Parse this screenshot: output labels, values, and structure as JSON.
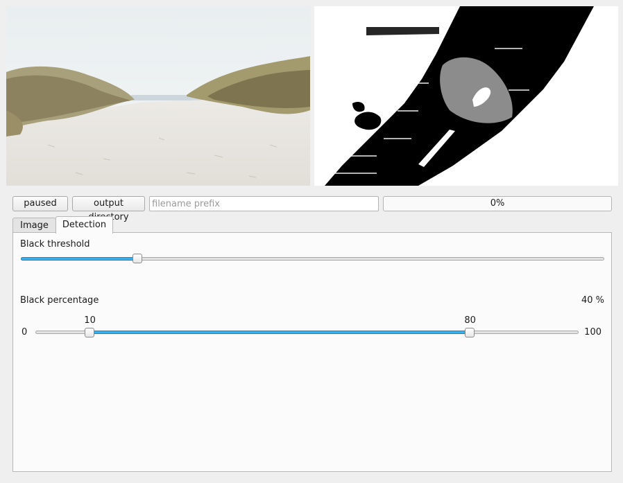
{
  "toolbar": {
    "paused_label": "paused",
    "output_directory_label": "output directory",
    "filename_prefix_placeholder": "filename prefix",
    "filename_prefix_value": "",
    "progress_text": "0%",
    "progress_value": 0
  },
  "tabs": [
    {
      "label": "Image",
      "active": false
    },
    {
      "label": "Detection",
      "active": true
    }
  ],
  "detection": {
    "black_threshold": {
      "label": "Black threshold",
      "value_fraction": 0.2
    },
    "black_percentage": {
      "label": "Black percentage",
      "current_text": "40 %",
      "range_min_text": "0",
      "range_max_text": "100",
      "lower_text": "10",
      "upper_text": "80",
      "min": 0,
      "max": 100,
      "lower": 10,
      "upper": 80
    }
  },
  "colors": {
    "accent": "#3daee9",
    "panel_bg": "#fbfbfb",
    "window_bg": "#efefef"
  }
}
